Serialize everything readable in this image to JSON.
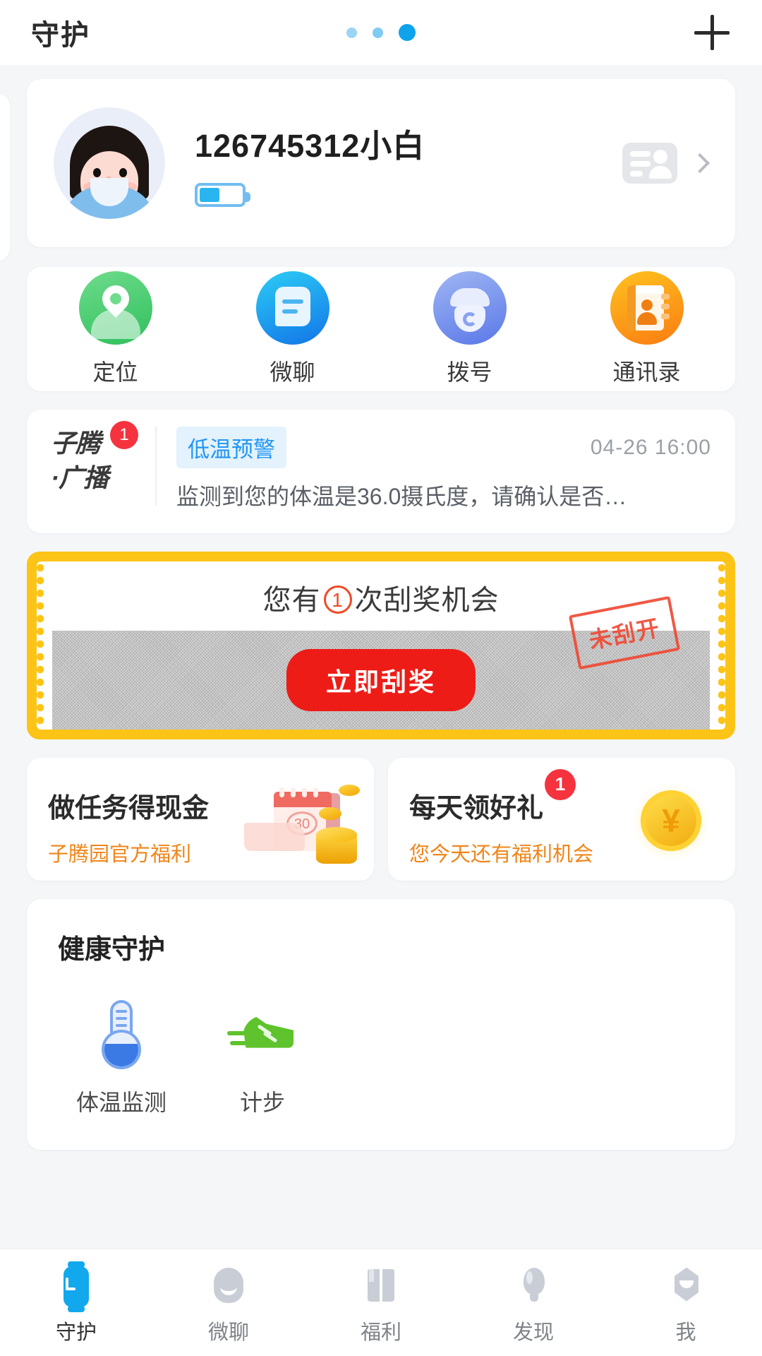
{
  "header": {
    "title": "守护",
    "pager": {
      "total": 3,
      "active_index": 3
    },
    "add_label": "+"
  },
  "user_card": {
    "name": "126745312小白",
    "battery_percent": 45,
    "avatar_icon": "child-avatar",
    "id_card_icon": "id-card-icon",
    "chevron_icon": "chevron-right-icon"
  },
  "quick_actions": [
    {
      "label": "定位",
      "icon": "location-pin-icon",
      "color": "#2fbf5d"
    },
    {
      "label": "微聊",
      "icon": "chat-bubble-icon",
      "color": "#1274e8"
    },
    {
      "label": "拨号",
      "icon": "telephone-icon",
      "color": "#5a78e8"
    },
    {
      "label": "通讯录",
      "icon": "contacts-book-icon",
      "color": "#fa7c12"
    }
  ],
  "broadcast": {
    "logo_line1": "子腾",
    "logo_line2": "·广播",
    "badge": "1",
    "tag": "低温预警",
    "tag_color": "#2196f3",
    "tag_bg": "#e3f2fd",
    "time": "04-26 16:00",
    "message": "监测到您的体温是36.0摄氏度，请确认是否…"
  },
  "ticket": {
    "title_prefix": "您有",
    "count": "1",
    "title_suffix": "次刮奖机会",
    "button_label": "立即刮奖",
    "stamp_label": "未刮开",
    "ticket_color": "#fcc417",
    "button_color": "#ee1c16"
  },
  "promos": [
    {
      "title": "做任务得现金",
      "subtitle": "子腾园官方福利",
      "subtitle_color": "#f08519",
      "art": "calendar-coins-art",
      "calendar_day": "30",
      "badge": null
    },
    {
      "title": "每天领好礼",
      "subtitle": "您今天还有福利机会",
      "subtitle_color": "#f08519",
      "art": "gold-coin-art",
      "coin_symbol": "¥",
      "badge": "1"
    }
  ],
  "health": {
    "title": "健康守护",
    "items": [
      {
        "label": "体温监测",
        "icon": "thermometer-icon",
        "color": "#3b7ae4"
      },
      {
        "label": "计步",
        "icon": "running-shoe-icon",
        "color": "#5ec32c"
      }
    ]
  },
  "tabbar": {
    "active_color": "#12a8ee",
    "items": [
      {
        "label": "守护",
        "icon": "watch-icon",
        "active": true
      },
      {
        "label": "微聊",
        "icon": "chat-icon",
        "active": false
      },
      {
        "label": "福利",
        "icon": "book-icon",
        "active": false
      },
      {
        "label": "发现",
        "icon": "lightbulb-icon",
        "active": false
      },
      {
        "label": "我",
        "icon": "person-icon",
        "active": false
      }
    ]
  }
}
